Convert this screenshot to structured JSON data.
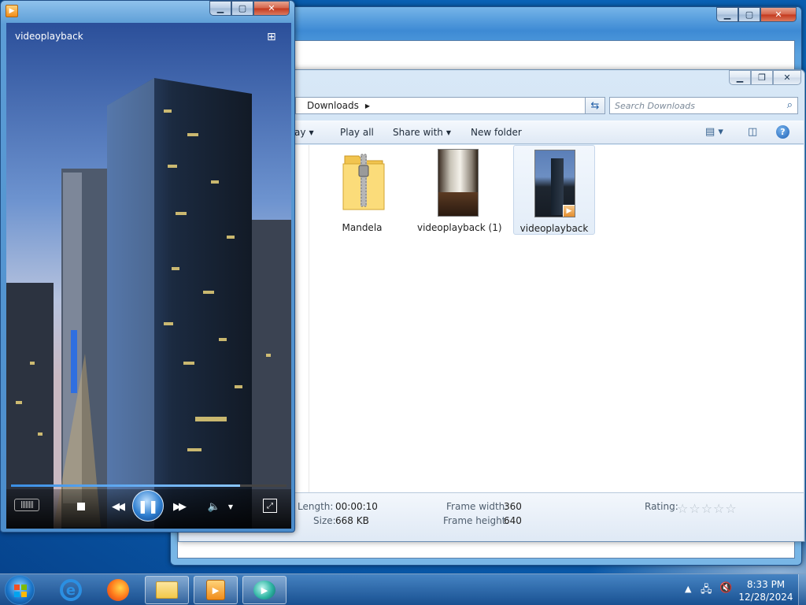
{
  "player": {
    "video_title": "videoplayback",
    "progress": 0.83
  },
  "explorer": {
    "breadcrumb": "Downloads",
    "search_placeholder": "Search Downloads",
    "toolbar": {
      "partial_left": "ay",
      "play_all": "Play all",
      "share_with": "Share with",
      "new_folder": "New folder"
    },
    "files": [
      {
        "name": "Mandela",
        "type": "zip-folder"
      },
      {
        "name": "videoplayback (1)",
        "type": "video"
      },
      {
        "name": "videoplayback",
        "type": "video",
        "selected": true
      }
    ],
    "details": {
      "length_label": "Length:",
      "length_value": "00:00:10",
      "size_label": "Size:",
      "size_value": "668 KB",
      "frame_width_label": "Frame width:",
      "frame_width_value": "360",
      "frame_height_label": "Frame height:",
      "frame_height_value": "640",
      "rating_label": "Rating:",
      "rating_value": 0
    }
  },
  "taskbar": {
    "time": "8:33 PM",
    "date": "12/28/2024"
  },
  "colors": {
    "accent": "#1f5ea6",
    "selection": "#e3edf8"
  }
}
